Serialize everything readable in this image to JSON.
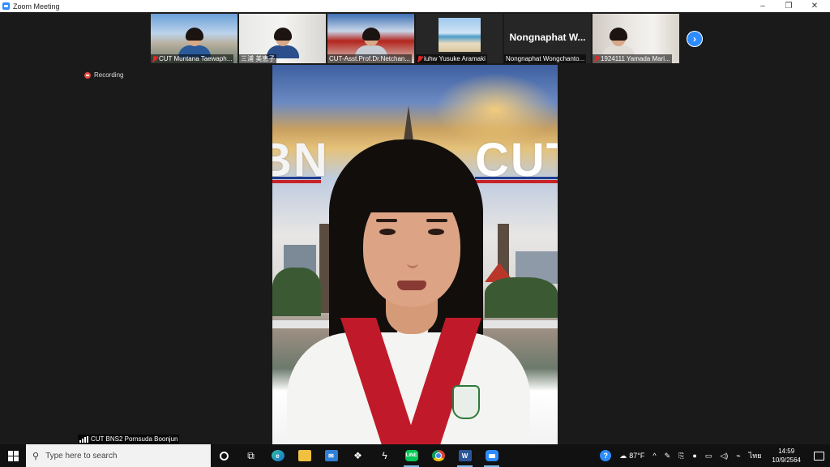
{
  "window": {
    "title": "Zoom Meeting",
    "controls": {
      "minimize": "–",
      "restore": "❐",
      "close": "✕"
    }
  },
  "status": {
    "recording_label": "Recording"
  },
  "participants": [
    {
      "name": "CUT Muntana Taewaph...",
      "muted": true
    },
    {
      "name": "三浦 美恵子",
      "muted": false
    },
    {
      "name": "CUT-Asst.Prof.Dr.Netchan...",
      "muted": false
    },
    {
      "name": "iuhw Yusuke Aramaki",
      "muted": true
    },
    {
      "name": "Nongnaphat Wongchanto...",
      "display_name": "Nongnaphat W...",
      "muted": false
    },
    {
      "name": "1924111 Yamada Mari...",
      "muted": true
    }
  ],
  "active_speaker": {
    "name": "CUT BNS2 Pornsuda Boonjun"
  },
  "background_text": {
    "left": "BN",
    "right": "CUT"
  },
  "taskbar": {
    "search_placeholder": "Type here to search",
    "weather": "87°F",
    "language": "ไทย",
    "time": "14:59",
    "date": "10/9/2564",
    "apps": [
      "task-view",
      "edge",
      "file-explorer",
      "mail",
      "dropbox",
      "app-s",
      "line",
      "chrome",
      "word",
      "zoom"
    ]
  },
  "colors": {
    "zoom_blue": "#2d8cff",
    "recording_red": "#e8463a",
    "taskbar_bg": "#111111"
  }
}
